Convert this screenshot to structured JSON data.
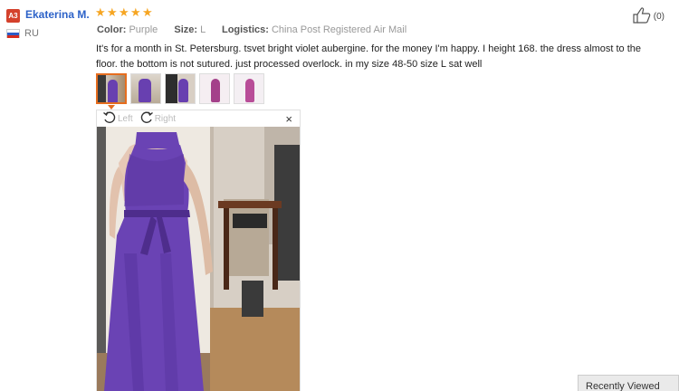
{
  "reviewer": {
    "badge": "A3",
    "name": "Ekaterina M.",
    "country": "RU"
  },
  "rating": {
    "stars": 5,
    "max": 5
  },
  "meta": {
    "color_label": "Color:",
    "color_value": "Purple",
    "size_label": "Size:",
    "size_value": "L",
    "logistics_label": "Logistics:",
    "logistics_value": "China Post Registered Air Mail"
  },
  "helpful": {
    "count": "(0)"
  },
  "review_text": "It's for a month in St. Petersburg. tsvet bright violet aubergine. for the money I'm happy. I height 168. the dress almost to the floor. the bottom is not sutured. just processed overlock. in my size 48-50 size L sat well",
  "thumbnails": [
    {
      "name": "photo-1",
      "active": true
    },
    {
      "name": "photo-2",
      "active": false
    },
    {
      "name": "photo-3",
      "active": false
    },
    {
      "name": "photo-4",
      "active": false
    },
    {
      "name": "photo-5",
      "active": false
    }
  ],
  "viewer": {
    "rotate_left": "Left",
    "rotate_right": "Right",
    "close": "×"
  },
  "recently_viewed": "Recently Viewed",
  "colors": {
    "name_blue": "#2c62c8",
    "star": "#f6a623",
    "badge": "#d4412c",
    "active_thumb": "#e66d1e",
    "dress": "#6a43b4"
  }
}
